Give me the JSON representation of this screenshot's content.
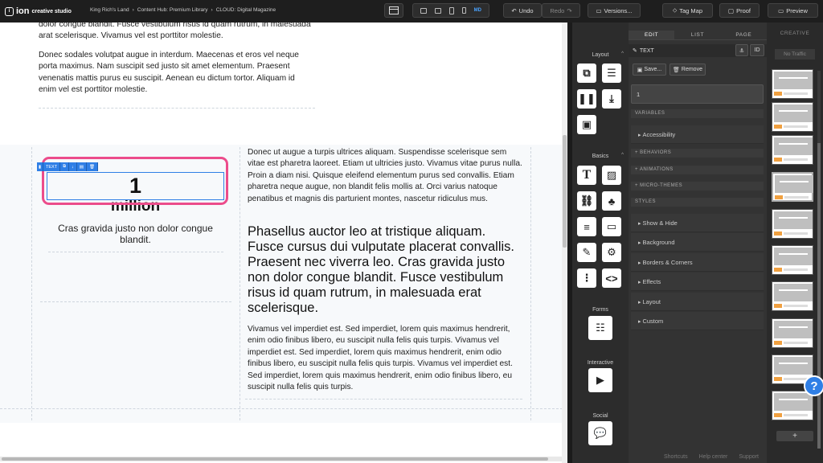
{
  "app": {
    "logo_glyph": "i",
    "logo_name": "ion",
    "logo_sub": "creative studio",
    "breadcrumbs": [
      "King Rich's Land",
      "›",
      "Content Hub: Premium Library",
      "›",
      "CLOUD: Digital Magazine"
    ]
  },
  "toolbar": {
    "device_md": "MD",
    "undo": "Undo",
    "redo": "Redo",
    "versions": "Versions...",
    "tag_map": "Tag Map",
    "proof": "Proof",
    "preview": "Preview"
  },
  "canvas": {
    "top_paragraph": "dolor congue blandit. Fusce vestibulum risus id quam rutrum, in malesuada arat scelerisque. Vivamus vel est porttitor molestie.",
    "top_paragraph_2": "Donec sodales volutpat augue in interdum. Maecenas et eros vel neque porta maximus. Nam suscipit sed justo sit amet elementum. Praesent venenatis mattis purus eu suscipit. Aenean eu dictum tortor. Aliquam id enim vel est porttitor molestie.",
    "stat_number": "1",
    "stat_unit": "million",
    "stat_caption": "Cras gravida justo non dolor congue blandit.",
    "right_paragraph": "Donec ut augue a turpis ultrices aliquam. Suspendisse scelerisque sem vitae est pharetra laoreet. Etiam ut ultricies justo. Vivamus vitae purus nulla. Proin a diam nisi. Quisque eleifend elementum purus sed convallis. Etiam pharetra neque augue, non blandit felis mollis at. Orci varius natoque penatibus et magnis dis parturient montes, nascetur ridiculus mus.",
    "heading": "Phasellus auctor leo at tristique aliquam. Fusce cursus dui vulputate placerat convallis. Praesent nec viverra leo. Cras gravida justo non dolor congue blandit. Fusce vestibulum risus id quam rutrum, in malesuada erat scelerisque.",
    "right_paragraph_2": "Vivamus vel imperdiet est. Sed imperdiet, lorem quis maximus hendrerit, enim odio finibus libero, eu suscipit nulla felis quis turpis. Vivamus vel imperdiet est. Sed imperdiet, lorem quis maximus hendrerit, enim odio finibus libero, eu suscipit nulla felis quis turpis. Vivamus vel imperdiet est. Sed imperdiet, lorem quis maximus hendrerit, enim odio finibus libero, eu suscipit nulla felis quis turpis.",
    "selection_tag": "TEXT"
  },
  "widgets": {
    "layout_label": "Layout",
    "basics_label": "Basics",
    "forms_label": "Forms",
    "interactive_label": "Interactive",
    "social_label": "Social",
    "chevron": "^"
  },
  "props": {
    "tabs": [
      "EDIT",
      "LIST",
      "PAGE"
    ],
    "element_type": "TEXT",
    "id_button": "ID",
    "save": "Save...",
    "remove": "Remove",
    "field_value": "1",
    "sections": {
      "variables": "VARIABLES",
      "behaviors": "+ BEHAVIORS",
      "animations": "+ ANIMATIONS",
      "micro_themes": "+ MICRO-THEMES",
      "styles": "STYLES"
    },
    "rows": {
      "accessibility": "Accessibility",
      "show_hide": "Show & Hide",
      "background": "Background",
      "borders": "Borders & Corners",
      "effects": "Effects",
      "layout": "Layout",
      "custom": "Custom"
    },
    "bottom": [
      "Shortcuts",
      "Help center",
      "Support"
    ]
  },
  "creative": {
    "tab": "CREATIVE",
    "no_traffic": "No Traffic",
    "add": "+",
    "help": "?"
  }
}
